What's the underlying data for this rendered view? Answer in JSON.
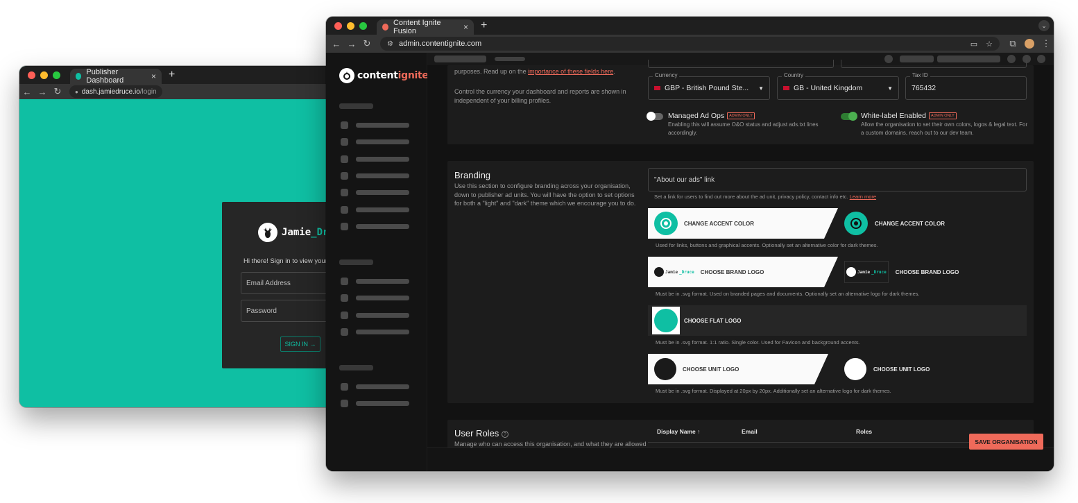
{
  "back_window": {
    "tab_title": "Publisher Dashboard",
    "tab_close": "×",
    "new_tab": "+",
    "url_host": "dash.jamiedruce.io",
    "url_path": "/login",
    "brand_name": "Jamie",
    "brand_accent": "_Dr",
    "greeting": "Hi there! Sign in to view your c",
    "email_placeholder": "Email Address",
    "password_placeholder": "Password",
    "sign_in": "SIGN IN →"
  },
  "front_window": {
    "tab_title": "Content Ignite Fusion",
    "tab_close": "×",
    "new_tab": "+",
    "url": "admin.contentignite.com",
    "logo_main": "content",
    "logo_accent": "ignite",
    "billing": {
      "text_part1": "purposes. Read up on the ",
      "link": "importance of these fields here",
      "text_part2": ".",
      "currency_desc": "Control the currency your dashboard and reports are shown in independent of your billing profiles.",
      "currency_label": "Currency",
      "currency_value": "GBP - British Pound Ste...",
      "country_label": "Country",
      "country_value": "GB - United Kingdom",
      "taxid_label": "Tax ID",
      "taxid_value": "765432",
      "managed_ad_ops": "Managed Ad Ops",
      "managed_badge": "ADMIN ONLY",
      "managed_desc": "Enabling this will assume O&O status and adjust ads.txt lines accordingly.",
      "whitelabel": "White-label Enabled",
      "whitelabel_badge": "ADMIN ONLY",
      "whitelabel_desc": "Allow the organisation to set their own colors, logos & legal text. For a custom domains, reach out to our dev team."
    },
    "branding": {
      "title": "Branding",
      "desc": "Use this section to configure branding across your organisation, down to publisher ad units. You will have the option to set options for both a \"light\" and \"dark\" theme which we encourage you to do.",
      "about_ads_placeholder": "\"About our ads\" link",
      "about_ads_help": "Set a link for users to find out more about the ad unit, privacy policy, contact info etc. ",
      "learn_more": "Learn more",
      "accent_light": "CHANGE ACCENT COLOR",
      "accent_dark": "CHANGE ACCENT COLOR",
      "accent_help": "Used for links, buttons and graphical accents. Optionally set an alternative color for dark themes.",
      "brand_logo_light": "CHOOSE BRAND LOGO",
      "brand_logo_dark": "CHOOSE BRAND LOGO",
      "brand_logo_text": "Jamie",
      "brand_logo_accent": "_Druce",
      "brand_logo_help": "Must be in .svg format. Used on branded pages and documents. Optionally set an alternative logo for dark themes.",
      "flat_logo": "CHOOSE FLAT LOGO",
      "flat_logo_help": "Must be in .svg format. 1:1 ratio. Single color. Used for Favicon and background accents.",
      "unit_logo_light": "CHOOSE UNIT LOGO",
      "unit_logo_dark": "CHOOSE UNIT LOGO",
      "unit_logo_help": "Must be in .svg format. Displayed at 20px by 20px. Additionally set an alternative logo for dark themes.",
      "accent_color": "#0fbfa3"
    },
    "user_roles": {
      "title": "User Roles",
      "help_icon": "help-circle-icon",
      "desc": "Manage who can access this organisation, and what they are allowed",
      "col_display_name": "Display Name ↑",
      "col_email": "Email",
      "col_roles": "Roles"
    },
    "save_button": "SAVE ORGANISATION",
    "accent_red": "#ef6a5a"
  }
}
